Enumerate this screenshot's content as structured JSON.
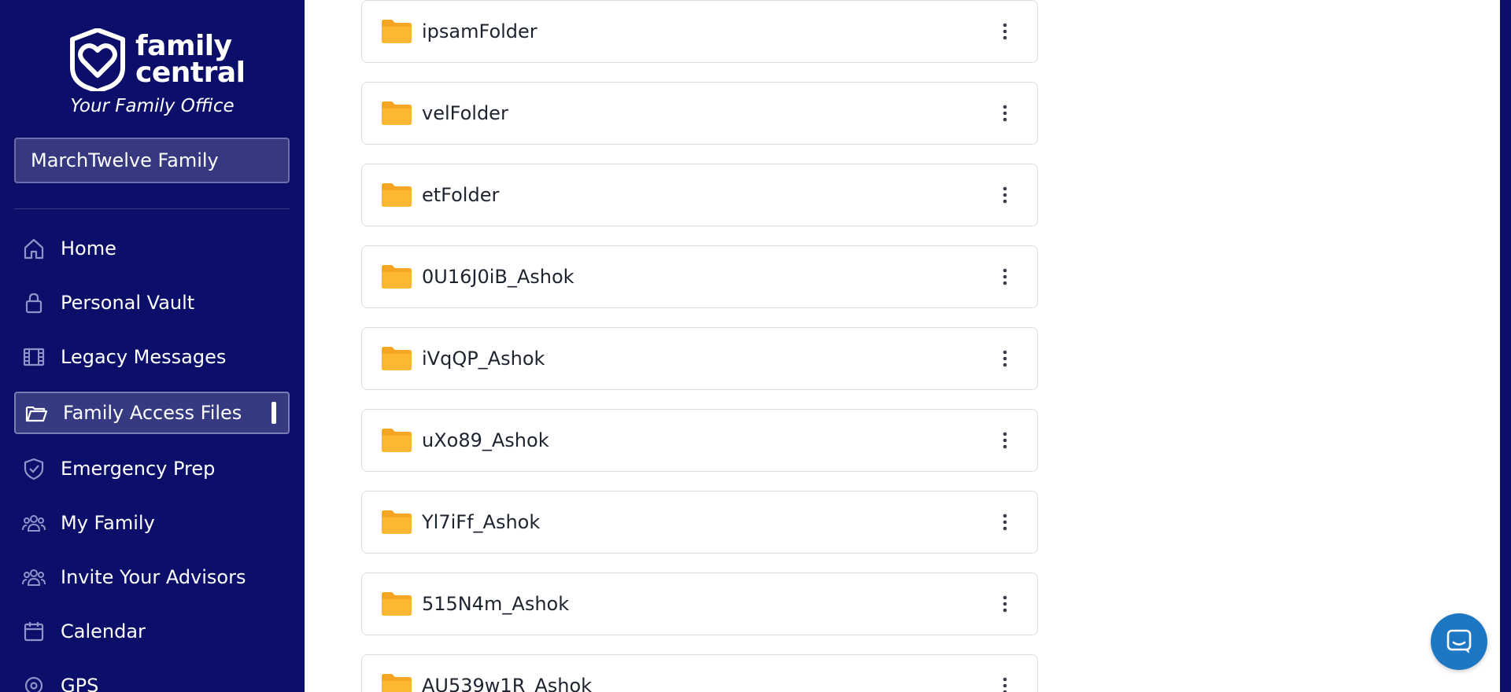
{
  "brand": {
    "line1": "family",
    "line2": "central",
    "tagline": "Your Family Office"
  },
  "family_selector": {
    "value": "MarchTwelve Family"
  },
  "nav": [
    {
      "label": "Home",
      "icon": "home-icon",
      "active": false
    },
    {
      "label": "Personal Vault",
      "icon": "lock-icon",
      "active": false
    },
    {
      "label": "Legacy Messages",
      "icon": "film-icon",
      "active": false
    },
    {
      "label": "Family Access Files",
      "icon": "folder-open-icon",
      "active": true
    },
    {
      "label": "Emergency Prep",
      "icon": "shield-check-icon",
      "active": false
    },
    {
      "label": "My Family",
      "icon": "people-icon",
      "active": false
    },
    {
      "label": "Invite Your Advisors",
      "icon": "people-icon",
      "active": false
    },
    {
      "label": "Calendar",
      "icon": "calendar-icon",
      "active": false
    },
    {
      "label": "GPS",
      "icon": "location-icon",
      "active": false
    }
  ],
  "folders": [
    {
      "name": "ipsamFolder"
    },
    {
      "name": "velFolder"
    },
    {
      "name": "etFolder"
    },
    {
      "name": "0U16J0iB_Ashok"
    },
    {
      "name": "iVqQP_Ashok"
    },
    {
      "name": "uXo89_Ashok"
    },
    {
      "name": "Yl7iFf_Ashok"
    },
    {
      "name": "515N4m_Ashok"
    },
    {
      "name": "AU539w1R_Ashok"
    }
  ],
  "colors": {
    "sidebar_bg": "#0c0f6a",
    "folder": "#f6a623",
    "chat_button": "#1d77c3"
  }
}
